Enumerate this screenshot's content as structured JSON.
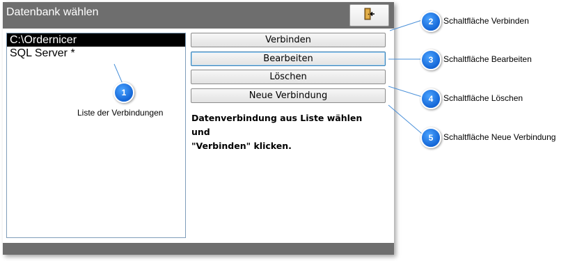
{
  "dialog": {
    "title": "Datenbank wählen",
    "exit_icon": "exit-door-icon"
  },
  "connection_list": {
    "items": [
      {
        "label": "C:\\Ordernicer",
        "selected": true
      },
      {
        "label": "SQL Server *",
        "selected": false
      }
    ]
  },
  "buttons": {
    "connect": "Verbinden",
    "edit": "Bearbeiten",
    "delete": "Löschen",
    "new_connection": "Neue Verbindung"
  },
  "info_text": "Datenverbindung aus Liste wählen und\n\"Verbinden\" klicken.",
  "annotations": [
    {
      "number": "1",
      "label": "Liste der Verbindungen"
    },
    {
      "number": "2",
      "label": "Schaltfläche Verbinden"
    },
    {
      "number": "3",
      "label": "Schaltfläche Bearbeiten"
    },
    {
      "number": "4",
      "label": "Schaltfläche Löschen"
    },
    {
      "number": "5",
      "label": "Schaltfläche Neue Verbindung"
    }
  ],
  "colors": {
    "titlebar": "#6e6e6e",
    "selection": "#000000",
    "badge": "#1a73e8",
    "leader_line": "#4a90d9"
  }
}
